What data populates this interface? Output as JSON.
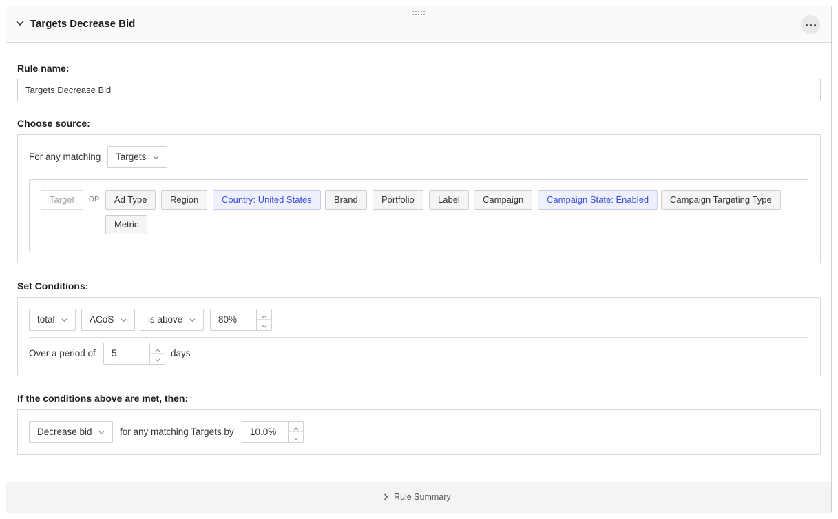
{
  "rule": {
    "title": "Targets Decrease Bid",
    "name_label": "Rule name:",
    "name_value": "Targets Decrease Bid"
  },
  "source": {
    "label": "Choose source:",
    "for_any_matching": "For any matching",
    "entity_select": "Targets",
    "or_label": "OR",
    "chips": [
      {
        "label": "Target",
        "state": "disabled"
      },
      {
        "label": "Ad Type",
        "state": "normal"
      },
      {
        "label": "Region",
        "state": "normal"
      },
      {
        "label": "Country: United States",
        "state": "active"
      },
      {
        "label": "Brand",
        "state": "normal"
      },
      {
        "label": "Portfolio",
        "state": "normal"
      },
      {
        "label": "Label",
        "state": "normal"
      },
      {
        "label": "Campaign",
        "state": "normal"
      },
      {
        "label": "Campaign State: Enabled",
        "state": "active"
      },
      {
        "label": "Campaign Targeting Type",
        "state": "normal"
      },
      {
        "label": "Metric",
        "state": "normal"
      }
    ]
  },
  "conditions": {
    "label": "Set Conditions:",
    "aggregate": "total",
    "metric": "ACoS",
    "operator": "is above",
    "threshold": "80%",
    "period_prefix": "Over a period of",
    "period_value": "5",
    "period_suffix": "days"
  },
  "action": {
    "label": "If the conditions above are met, then:",
    "action_select": "Decrease bid",
    "middle_text": "for any matching Targets by",
    "amount": "10.0%"
  },
  "footer": {
    "summary_label": "Rule Summary"
  },
  "colors": {
    "active_chip_text": "#3b4fd8",
    "active_chip_bg": "#eef1fd",
    "border": "#d0d0d0"
  }
}
